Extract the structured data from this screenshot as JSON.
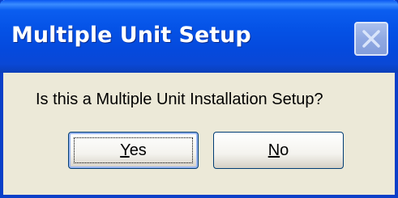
{
  "dialog": {
    "title": "Multiple Unit Setup",
    "message": "Is this a Multiple Unit Installation Setup?",
    "close_icon": "close-icon",
    "buttons": {
      "yes": {
        "mnemonic": "Y",
        "rest": "es",
        "default": true
      },
      "no": {
        "mnemonic": "N",
        "rest": "o",
        "default": false
      }
    }
  },
  "colors": {
    "titlebar": "#0552e6",
    "frame": "#0a3fc8",
    "body": "#ece9d8",
    "button_border": "#003c74"
  }
}
